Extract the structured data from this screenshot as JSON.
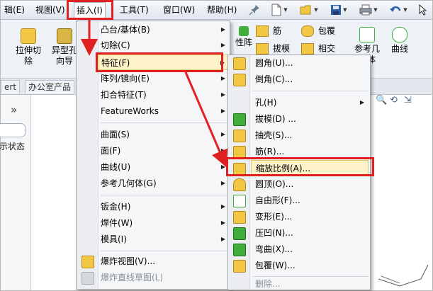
{
  "menubar": {
    "items": [
      {
        "label": "辑(E)"
      },
      {
        "label": "视图(V)"
      },
      {
        "label": "插入(I)"
      },
      {
        "label": "工具(T)"
      },
      {
        "label": "窗口(W)"
      },
      {
        "label": "帮助(H)"
      }
    ]
  },
  "ribbon": {
    "buttons": [
      {
        "label": "拉伸切\n除"
      },
      {
        "label": "异型孔\n向导"
      },
      {
        "label": "筋"
      },
      {
        "label": "包覆"
      },
      {
        "label": "拔模"
      },
      {
        "label": "相交"
      },
      {
        "label": "性阵"
      },
      {
        "label": "参考几\n何体"
      },
      {
        "label": "曲线"
      }
    ]
  },
  "tabs": [
    {
      "label": "ert"
    },
    {
      "label": "办公室产品"
    }
  ],
  "leftpanel": {
    "status_text": "示状态"
  },
  "insert_menu": {
    "items": [
      {
        "label": "凸台/基体(B)",
        "submenu": true
      },
      {
        "label": "切除(C)",
        "submenu": true
      },
      {
        "label": "特征(F)",
        "submenu": true
      },
      {
        "label": "阵列/镜向(E)",
        "submenu": true
      },
      {
        "label": "扣合特征(T)",
        "submenu": true
      },
      {
        "label": "FeatureWorks",
        "submenu": true
      },
      {
        "label": "曲面(S)",
        "submenu": true
      },
      {
        "label": "面(F)",
        "submenu": true
      },
      {
        "label": "曲线(U)",
        "submenu": true
      },
      {
        "label": "参考几何体(G)",
        "submenu": true
      },
      {
        "label": "钣金(H)",
        "submenu": true
      },
      {
        "label": "焊件(W)",
        "submenu": true
      },
      {
        "label": "模具(I)",
        "submenu": true
      },
      {
        "label": "爆炸视图(V)..."
      },
      {
        "label": "爆炸直线草图(L)"
      }
    ]
  },
  "feature_menu": {
    "items": [
      {
        "label": "圆角(U)..."
      },
      {
        "label": "倒角(C)..."
      },
      {
        "label": "孔(H)",
        "submenu": true
      },
      {
        "label": "拔模(D) ..."
      },
      {
        "label": "抽壳(S)..."
      },
      {
        "label": "筋(R)..."
      },
      {
        "label": "缩放比例(A)..."
      },
      {
        "label": "圆顶(O)..."
      },
      {
        "label": "自由形(F)..."
      },
      {
        "label": "变形(E)..."
      },
      {
        "label": "压凹(N)..."
      },
      {
        "label": "弯曲(X)..."
      },
      {
        "label": "包覆(W)..."
      },
      {
        "label": "删除..."
      }
    ]
  },
  "colors": {
    "highlight_border": "#e02020",
    "menu_background": "#f5f6f8",
    "icon_yellow": "#f2c744",
    "icon_green": "#3fae3a"
  },
  "icons": [
    "pin-icon",
    "new-document-icon",
    "open-folder-icon",
    "save-icon",
    "print-icon",
    "undo-icon",
    "select-cursor-icon"
  ]
}
